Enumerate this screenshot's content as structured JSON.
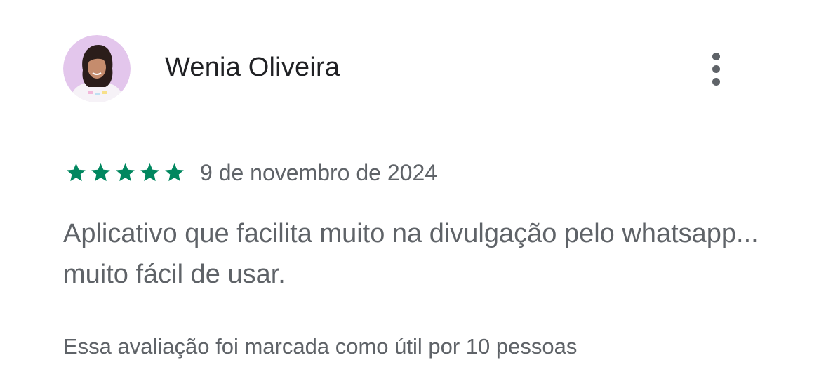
{
  "review": {
    "author": {
      "name": "Wenia Oliveira",
      "avatar_icon": "user-avatar-photo"
    },
    "more_options_icon": "more-vert-icon",
    "rating": {
      "stars": 5,
      "max_stars": 5,
      "star_color": "#01875f"
    },
    "date": "9 de novembro de 2024",
    "text": "Aplicativo que facilita muito na divulgação pelo whatsapp... muito fácil de usar.",
    "helpful": "Essa avaliação foi marcada como útil por 10 pessoas"
  }
}
